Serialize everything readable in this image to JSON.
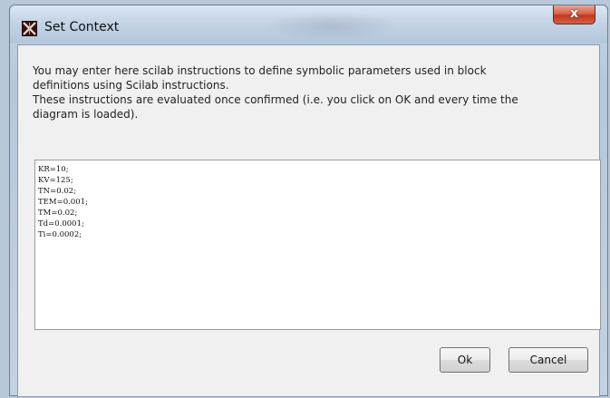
{
  "window": {
    "title": "Set Context",
    "close_label": "x",
    "icon": "scilab-app-icon"
  },
  "description": {
    "line1": "You may enter here scilab instructions to define symbolic parameters used in block",
    "line2": "definitions using Scilab instructions.",
    "line3": "These instructions are evaluated once confirmed (i.e. you click on OK and every time the",
    "line4": "diagram is loaded)."
  },
  "editor": {
    "lines": [
      "KR=10;",
      "KV=125;",
      "TN=0.02;",
      "TEM=0.001;",
      "TM=0.02;",
      "Td=0.0001;",
      "Ti=0.0002;"
    ]
  },
  "buttons": {
    "ok": "Ok",
    "cancel": "Cancel"
  }
}
